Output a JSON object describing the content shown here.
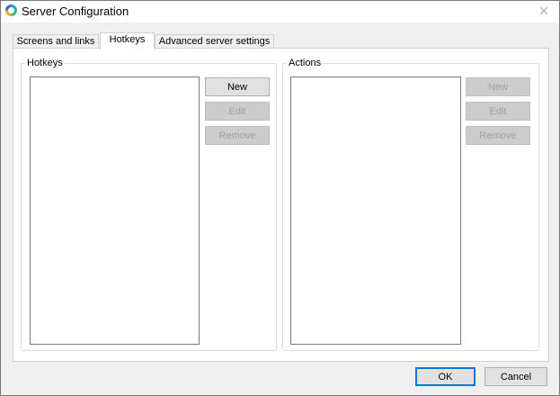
{
  "window": {
    "title": "Server Configuration",
    "app_icon": "app-logo-icon",
    "close_icon": "close-icon"
  },
  "tabs": [
    {
      "label": "Screens and links",
      "active": false
    },
    {
      "label": "Hotkeys",
      "active": true
    },
    {
      "label": "Advanced server settings",
      "active": false
    }
  ],
  "hotkeys_group": {
    "label": "Hotkeys",
    "buttons": {
      "new": {
        "label": "New",
        "enabled": true
      },
      "edit": {
        "label": "Edit",
        "enabled": false
      },
      "remove": {
        "label": "Remove",
        "enabled": false
      }
    }
  },
  "actions_group": {
    "label": "Actions",
    "buttons": {
      "new": {
        "label": "New",
        "enabled": false
      },
      "edit": {
        "label": "Edit",
        "enabled": false
      },
      "remove": {
        "label": "Remove",
        "enabled": false
      }
    }
  },
  "footer": {
    "ok_label": "OK",
    "cancel_label": "Cancel"
  },
  "colors": {
    "accent": "#0078d7",
    "window_bg": "#f0f0f0",
    "disabled_text": "#a0a0a0"
  }
}
